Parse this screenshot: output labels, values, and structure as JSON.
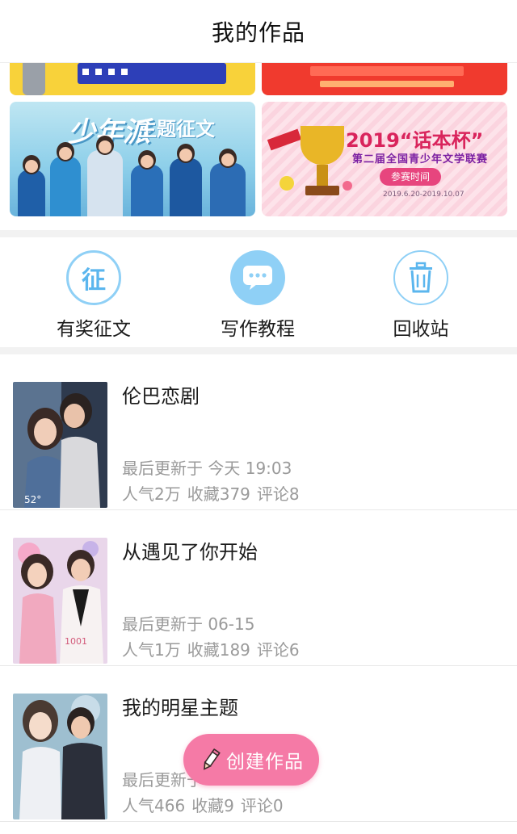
{
  "header": {
    "title": "我的作品"
  },
  "banners": {
    "shaonian": {
      "big": "少年派",
      "sub": "主题征文"
    },
    "huaben": {
      "year": "2019“话本杯”",
      "line2": "第二届全国青少年文学联赛",
      "pill": "参赛时间",
      "date": "2019.6.20-2019.10.07"
    }
  },
  "shortcuts": [
    {
      "label": "有奖征文",
      "glyph": "征",
      "icon": "prize-essay-icon"
    },
    {
      "label": "写作教程",
      "icon": "chat-bubble-icon"
    },
    {
      "label": "回收站",
      "icon": "trash-icon"
    }
  ],
  "works": [
    {
      "title": "伦巴恋剧",
      "update": "最后更新于 今天 19:03",
      "stats": [
        "人气2万",
        "收藏379",
        "评论8"
      ]
    },
    {
      "title": "从遇见了你开始",
      "update": "最后更新于 06-15",
      "stats": [
        "人气1万",
        "收藏189",
        "评论6"
      ]
    },
    {
      "title": "我的明星主题",
      "update": "最后更新于",
      "stats": [
        "人气466",
        "收藏9",
        "评论0"
      ]
    }
  ],
  "create_button": {
    "label": "创建作品",
    "icon": "pencil-icon"
  },
  "colors": {
    "accent_blue": "#8fd0f6",
    "accent_pink": "#f57aa6",
    "muted_text": "#9a9a9a"
  }
}
